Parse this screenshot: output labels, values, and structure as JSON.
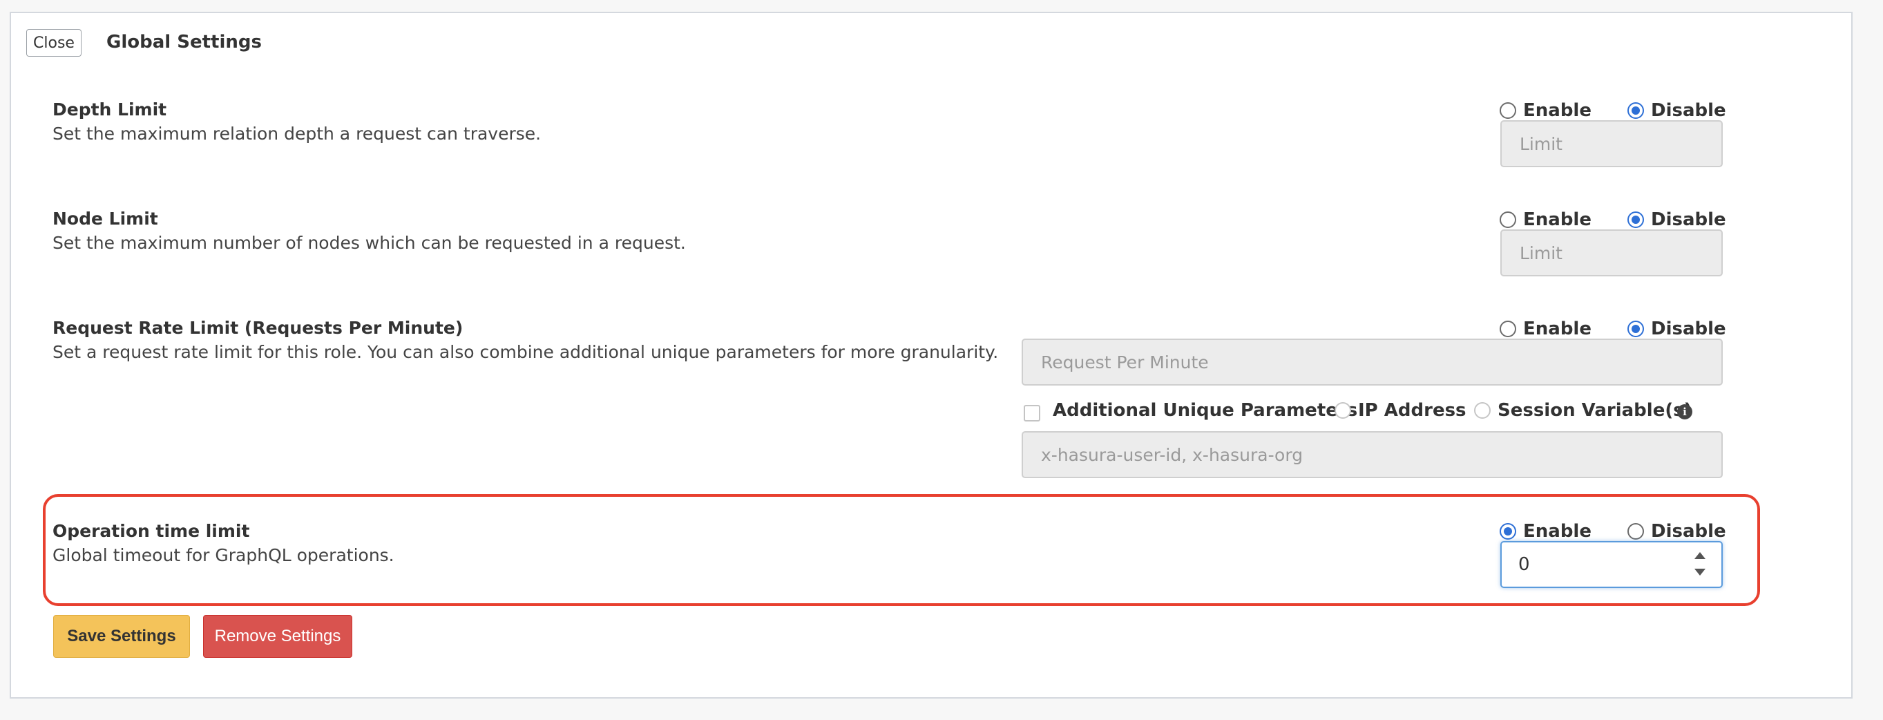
{
  "header": {
    "close_label": "Close",
    "title": "Global Settings"
  },
  "radio_labels": {
    "enable": "Enable",
    "disable": "Disable"
  },
  "sections": {
    "depth_limit": {
      "title": "Depth Limit",
      "description": "Set the maximum relation depth a request can traverse.",
      "selected": "disable",
      "input_placeholder": "Limit"
    },
    "node_limit": {
      "title": "Node Limit",
      "description": "Set the maximum number of nodes which can be requested in a request.",
      "selected": "disable",
      "input_placeholder": "Limit"
    },
    "rate_limit": {
      "title": "Request Rate Limit (Requests Per Minute)",
      "description": "Set a request rate limit for this role. You can also combine additional unique parameters for more granularity.",
      "selected": "disable",
      "input_placeholder": "Request Per Minute",
      "additional_params_label": "Additional Unique Parameters",
      "ip_address_label": "IP Address",
      "session_variables_label": "Session Variable(s)",
      "session_vars_placeholder": "x-hasura-user-id, x-hasura-org"
    },
    "operation_time_limit": {
      "title": "Operation time limit",
      "description": "Global timeout for GraphQL operations.",
      "selected": "enable",
      "value": "0"
    }
  },
  "footer": {
    "save_label": "Save Settings",
    "remove_label": "Remove Settings"
  },
  "colors": {
    "accent_blue": "#2d6fd6",
    "highlight_red": "#e8402f",
    "save_yellow": "#f4c35a",
    "remove_red": "#d9534f"
  },
  "icons": {
    "info": "info-icon",
    "spinner_up": "chevron-up-icon",
    "spinner_down": "chevron-down-icon"
  }
}
